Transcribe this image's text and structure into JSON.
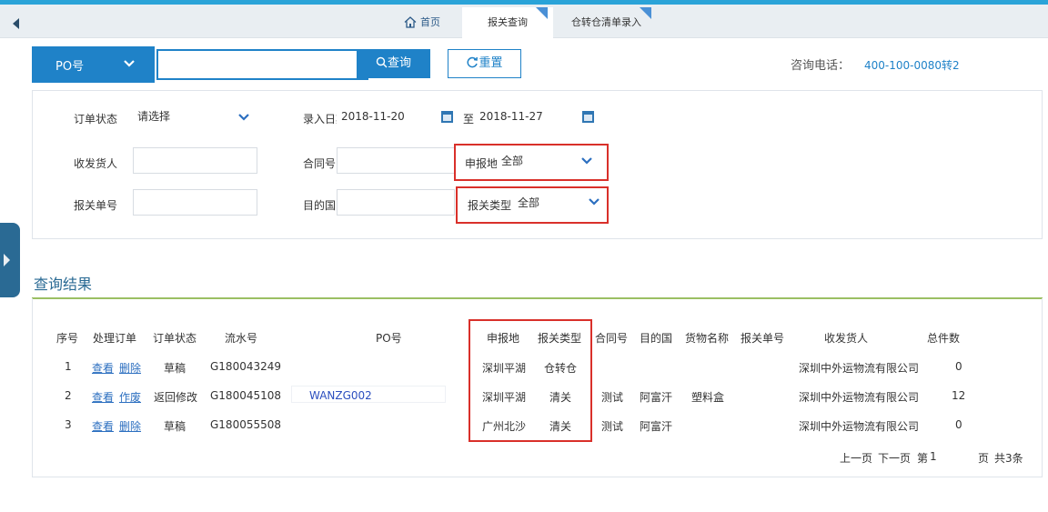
{
  "tabs": [
    {
      "label": "首页"
    },
    {
      "label": "报关查询"
    },
    {
      "label": "仓转仓清单录入"
    }
  ],
  "search": {
    "field_label": "PO号",
    "value": "",
    "query_label": "查询",
    "reset_label": "重置"
  },
  "hotline": {
    "label": "咨询电话：",
    "number": "400-100-0080转2"
  },
  "filters": {
    "order_status_label": "订单状态",
    "order_status_value": "请选择",
    "entry_date_label": "录入日期",
    "date_from": "2018-11-20",
    "date_to_label": "至",
    "date_to": "2018-11-27",
    "shipper_label": "收发货人",
    "shipper_value": "",
    "contract_label": "合同号",
    "contract_value": "",
    "declare_place_label": "申报地",
    "declare_place_value": "全部",
    "declare_no_label": "报关单号",
    "declare_no_value": "",
    "dest_label": "目的国",
    "dest_value": "",
    "declare_type_label": "报关类型",
    "declare_type_value": "全部"
  },
  "results": {
    "title": "查询结果",
    "headers": [
      "序号",
      "处理订单",
      "订单状态",
      "流水号",
      "PO号",
      "申报地",
      "报关类型",
      "合同号",
      "目的国",
      "货物名称",
      "报关单号",
      "收发货人",
      "总件数"
    ],
    "rows": [
      {
        "no": "1",
        "action1": "查看",
        "action2": "删除",
        "status": "草稿",
        "serial": "G180043249",
        "po": "",
        "place": "深圳平湖",
        "type": "仓转仓",
        "contract": "",
        "dest": "",
        "goods": "",
        "declno": "",
        "shipper": "深圳中外运物流有限公司",
        "count": "0"
      },
      {
        "no": "2",
        "action1": "查看",
        "action2": "作废",
        "status": "返回修改",
        "serial": "G180045108",
        "po": "WANZG002",
        "place": "深圳平湖",
        "type": "清关",
        "contract": "测试",
        "dest": "阿富汗",
        "goods": "塑料盒",
        "declno": "",
        "shipper": "深圳中外运物流有限公司",
        "count": "12"
      },
      {
        "no": "3",
        "action1": "查看",
        "action2": "删除",
        "status": "草稿",
        "serial": "G180055508",
        "po": "",
        "place": "广州北沙",
        "type": "清关",
        "contract": "测试",
        "dest": "阿富汗",
        "goods": "",
        "declno": "",
        "shipper": "深圳中外运物流有限公司",
        "count": "0"
      }
    ]
  },
  "pager": {
    "prev": "上一页",
    "next": "下一页",
    "page_prefix": "第",
    "page": "1",
    "page_suffix": "页",
    "total": "共3条"
  },
  "colors": {
    "primary": "#1f82c8",
    "highlight": "#d9302a",
    "title": "#2a6a94",
    "accent_line": "#9bbf63"
  }
}
